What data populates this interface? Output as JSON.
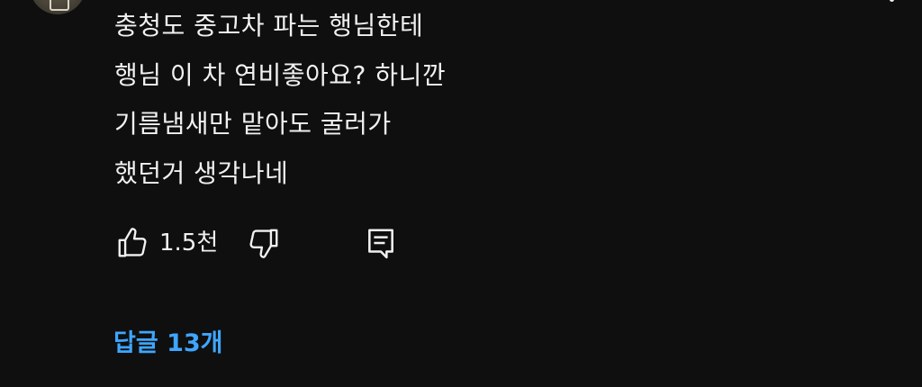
{
  "comment": {
    "lines": [
      "충청도 중고차 파는 행님한테",
      "행님 이 차 연비좋아요? 하니깐",
      "기름냄새만 맡아도 굴러가",
      "했던거 생각나네"
    ]
  },
  "actions": {
    "like_count": "1.5천",
    "like_icon": "thumb-up-icon",
    "dislike_icon": "thumb-down-icon",
    "reply_icon": "comment-icon"
  },
  "replies": {
    "label": "답글 13개"
  },
  "colors": {
    "background": "#0f0f0f",
    "text": "#f1f1f1",
    "link": "#3ea6ff"
  }
}
